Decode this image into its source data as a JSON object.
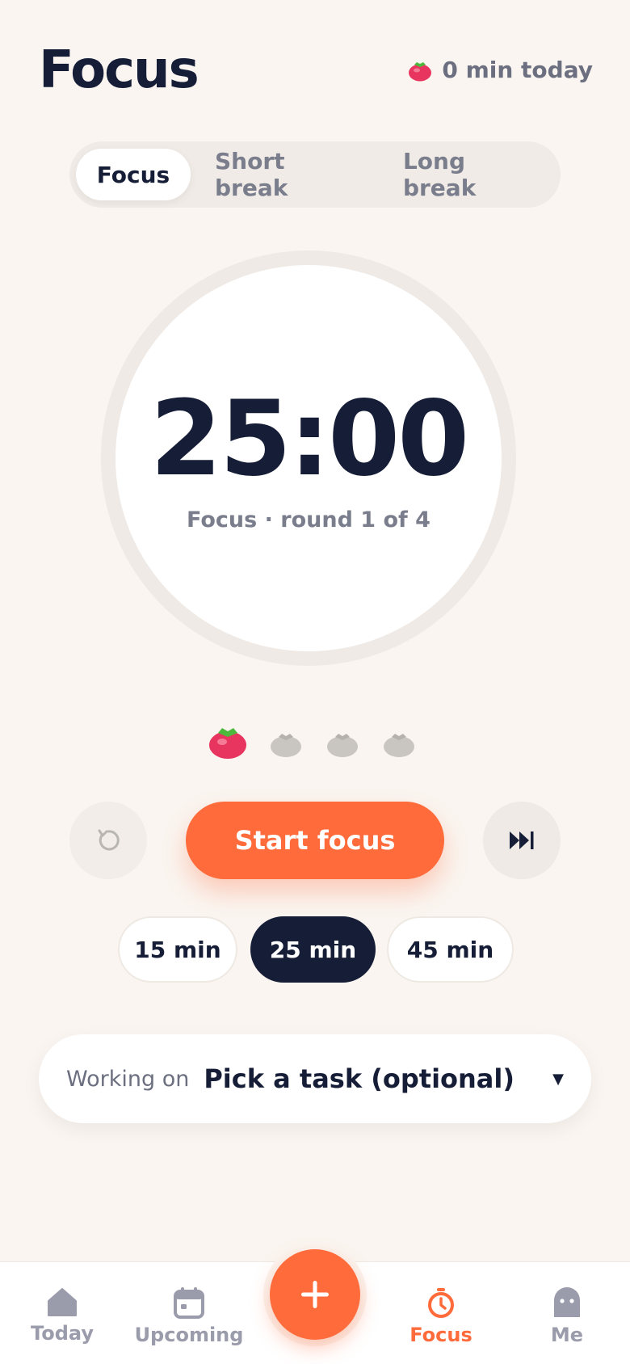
{
  "header": {
    "title": "Focus",
    "today_stat": "0 min today"
  },
  "modes": {
    "items": [
      "Focus",
      "Short break",
      "Long break"
    ],
    "active_index": 0
  },
  "timer": {
    "time": "25:00",
    "subtitle": "Focus · round 1 of 4"
  },
  "rounds": {
    "total": 4,
    "completed_or_current": 1
  },
  "controls": {
    "start_label": "Start focus",
    "reset_icon": "reset-icon",
    "skip_icon": "skip-icon"
  },
  "presets": {
    "items": [
      "15 min",
      "25 min",
      "45 min"
    ],
    "selected": "25 min"
  },
  "task": {
    "label": "Working on",
    "value": "Pick a task (optional)"
  },
  "nav": {
    "items": [
      "Today",
      "Upcoming",
      "Focus",
      "Me"
    ],
    "active": "Focus"
  },
  "colors": {
    "accent": "#ff6b3b",
    "dark": "#161d36",
    "background": "#faf5f0"
  }
}
